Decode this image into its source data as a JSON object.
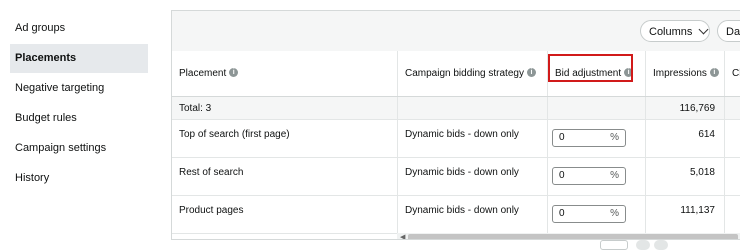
{
  "sidebar": {
    "items": [
      {
        "label": "Ad groups",
        "active": false
      },
      {
        "label": "Placements",
        "active": true
      },
      {
        "label": "Negative targeting",
        "active": false
      },
      {
        "label": "Budget rules",
        "active": false
      },
      {
        "label": "Campaign settings",
        "active": false
      },
      {
        "label": "History",
        "active": false
      }
    ]
  },
  "toolbar": {
    "columns_label": "Columns",
    "date_label": "Dat"
  },
  "table": {
    "headers": {
      "placement": "Placement",
      "strategy": "Campaign bidding strategy",
      "bid_adjustment": "Bid adjustment",
      "impressions": "Impressions",
      "clicks": "Cli"
    },
    "total": {
      "label": "Total: 3",
      "impressions": "116,769"
    },
    "rows": [
      {
        "placement": "Top of search (first page)",
        "strategy": "Dynamic bids - down only",
        "bid_value": "0",
        "bid_unit": "%",
        "impressions": "614"
      },
      {
        "placement": "Rest of search",
        "strategy": "Dynamic bids - down only",
        "bid_value": "0",
        "bid_unit": "%",
        "impressions": "5,018"
      },
      {
        "placement": "Product pages",
        "strategy": "Dynamic bids - down only",
        "bid_value": "0",
        "bid_unit": "%",
        "impressions": "111,137"
      }
    ]
  },
  "colors": {
    "highlight": "#d11a1a",
    "active_nav_bg": "#e6e9ec",
    "toolbar_bg": "#f5f6f6"
  }
}
